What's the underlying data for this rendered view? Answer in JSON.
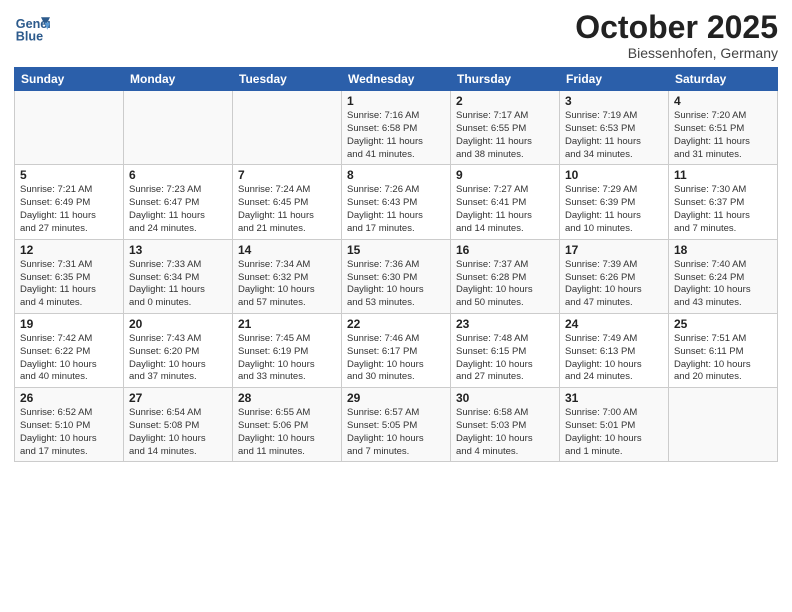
{
  "header": {
    "logo_line1": "General",
    "logo_line2": "Blue",
    "month": "October 2025",
    "location": "Biessenhofen, Germany"
  },
  "weekdays": [
    "Sunday",
    "Monday",
    "Tuesday",
    "Wednesday",
    "Thursday",
    "Friday",
    "Saturday"
  ],
  "weeks": [
    [
      {
        "day": "",
        "info": ""
      },
      {
        "day": "",
        "info": ""
      },
      {
        "day": "",
        "info": ""
      },
      {
        "day": "1",
        "info": "Sunrise: 7:16 AM\nSunset: 6:58 PM\nDaylight: 11 hours\nand 41 minutes."
      },
      {
        "day": "2",
        "info": "Sunrise: 7:17 AM\nSunset: 6:55 PM\nDaylight: 11 hours\nand 38 minutes."
      },
      {
        "day": "3",
        "info": "Sunrise: 7:19 AM\nSunset: 6:53 PM\nDaylight: 11 hours\nand 34 minutes."
      },
      {
        "day": "4",
        "info": "Sunrise: 7:20 AM\nSunset: 6:51 PM\nDaylight: 11 hours\nand 31 minutes."
      }
    ],
    [
      {
        "day": "5",
        "info": "Sunrise: 7:21 AM\nSunset: 6:49 PM\nDaylight: 11 hours\nand 27 minutes."
      },
      {
        "day": "6",
        "info": "Sunrise: 7:23 AM\nSunset: 6:47 PM\nDaylight: 11 hours\nand 24 minutes."
      },
      {
        "day": "7",
        "info": "Sunrise: 7:24 AM\nSunset: 6:45 PM\nDaylight: 11 hours\nand 21 minutes."
      },
      {
        "day": "8",
        "info": "Sunrise: 7:26 AM\nSunset: 6:43 PM\nDaylight: 11 hours\nand 17 minutes."
      },
      {
        "day": "9",
        "info": "Sunrise: 7:27 AM\nSunset: 6:41 PM\nDaylight: 11 hours\nand 14 minutes."
      },
      {
        "day": "10",
        "info": "Sunrise: 7:29 AM\nSunset: 6:39 PM\nDaylight: 11 hours\nand 10 minutes."
      },
      {
        "day": "11",
        "info": "Sunrise: 7:30 AM\nSunset: 6:37 PM\nDaylight: 11 hours\nand 7 minutes."
      }
    ],
    [
      {
        "day": "12",
        "info": "Sunrise: 7:31 AM\nSunset: 6:35 PM\nDaylight: 11 hours\nand 4 minutes."
      },
      {
        "day": "13",
        "info": "Sunrise: 7:33 AM\nSunset: 6:34 PM\nDaylight: 11 hours\nand 0 minutes."
      },
      {
        "day": "14",
        "info": "Sunrise: 7:34 AM\nSunset: 6:32 PM\nDaylight: 10 hours\nand 57 minutes."
      },
      {
        "day": "15",
        "info": "Sunrise: 7:36 AM\nSunset: 6:30 PM\nDaylight: 10 hours\nand 53 minutes."
      },
      {
        "day": "16",
        "info": "Sunrise: 7:37 AM\nSunset: 6:28 PM\nDaylight: 10 hours\nand 50 minutes."
      },
      {
        "day": "17",
        "info": "Sunrise: 7:39 AM\nSunset: 6:26 PM\nDaylight: 10 hours\nand 47 minutes."
      },
      {
        "day": "18",
        "info": "Sunrise: 7:40 AM\nSunset: 6:24 PM\nDaylight: 10 hours\nand 43 minutes."
      }
    ],
    [
      {
        "day": "19",
        "info": "Sunrise: 7:42 AM\nSunset: 6:22 PM\nDaylight: 10 hours\nand 40 minutes."
      },
      {
        "day": "20",
        "info": "Sunrise: 7:43 AM\nSunset: 6:20 PM\nDaylight: 10 hours\nand 37 minutes."
      },
      {
        "day": "21",
        "info": "Sunrise: 7:45 AM\nSunset: 6:19 PM\nDaylight: 10 hours\nand 33 minutes."
      },
      {
        "day": "22",
        "info": "Sunrise: 7:46 AM\nSunset: 6:17 PM\nDaylight: 10 hours\nand 30 minutes."
      },
      {
        "day": "23",
        "info": "Sunrise: 7:48 AM\nSunset: 6:15 PM\nDaylight: 10 hours\nand 27 minutes."
      },
      {
        "day": "24",
        "info": "Sunrise: 7:49 AM\nSunset: 6:13 PM\nDaylight: 10 hours\nand 24 minutes."
      },
      {
        "day": "25",
        "info": "Sunrise: 7:51 AM\nSunset: 6:11 PM\nDaylight: 10 hours\nand 20 minutes."
      }
    ],
    [
      {
        "day": "26",
        "info": "Sunrise: 6:52 AM\nSunset: 5:10 PM\nDaylight: 10 hours\nand 17 minutes."
      },
      {
        "day": "27",
        "info": "Sunrise: 6:54 AM\nSunset: 5:08 PM\nDaylight: 10 hours\nand 14 minutes."
      },
      {
        "day": "28",
        "info": "Sunrise: 6:55 AM\nSunset: 5:06 PM\nDaylight: 10 hours\nand 11 minutes."
      },
      {
        "day": "29",
        "info": "Sunrise: 6:57 AM\nSunset: 5:05 PM\nDaylight: 10 hours\nand 7 minutes."
      },
      {
        "day": "30",
        "info": "Sunrise: 6:58 AM\nSunset: 5:03 PM\nDaylight: 10 hours\nand 4 minutes."
      },
      {
        "day": "31",
        "info": "Sunrise: 7:00 AM\nSunset: 5:01 PM\nDaylight: 10 hours\nand 1 minute."
      },
      {
        "day": "",
        "info": ""
      }
    ]
  ]
}
